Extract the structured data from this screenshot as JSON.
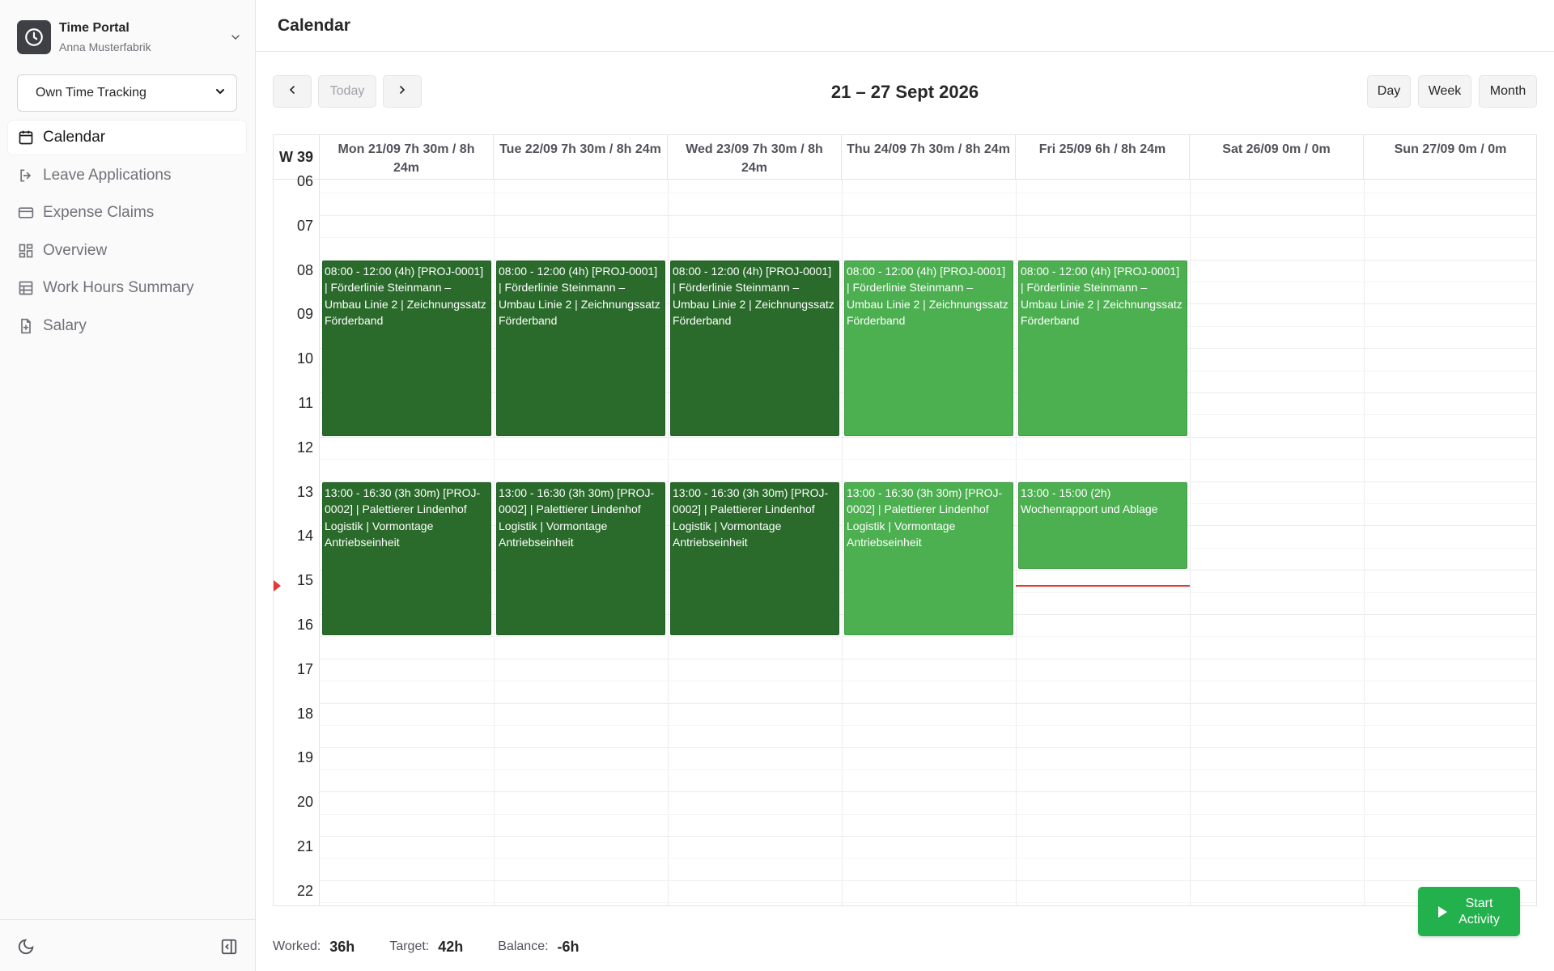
{
  "app": {
    "title": "Time Portal",
    "user": "Anna Musterfabrik"
  },
  "tracking_select": {
    "value": "Own Time Tracking"
  },
  "sidebar": {
    "items": [
      {
        "label": "Calendar",
        "icon": "calendar-icon",
        "active": true
      },
      {
        "label": "Leave Applications",
        "icon": "leave-icon"
      },
      {
        "label": "Expense Claims",
        "icon": "credit-card-icon"
      },
      {
        "label": "Overview",
        "icon": "grid-icon"
      },
      {
        "label": "Work Hours Summary",
        "icon": "table-icon"
      },
      {
        "label": "Salary",
        "icon": "document-icon"
      }
    ]
  },
  "header": {
    "title": "Calendar"
  },
  "toolbar": {
    "today_label": "Today",
    "range_title": "21 – 27 Sept 2026",
    "views": [
      "Day",
      "Week",
      "Month"
    ]
  },
  "calendar": {
    "week_label": "W 39",
    "days": [
      "Mon 21/09 7h 30m / 8h 24m",
      "Tue 22/09 7h 30m / 8h 24m",
      "Wed 23/09 7h 30m / 8h 24m",
      "Thu 24/09 7h 30m / 8h 24m",
      "Fri 25/09 6h / 8h 24m",
      "Sat 26/09 0m / 0m",
      "Sun 27/09 0m / 0m"
    ],
    "hours": [
      "06",
      "07",
      "08",
      "09",
      "10",
      "11",
      "12",
      "13",
      "14",
      "15",
      "16",
      "17",
      "18",
      "19",
      "20",
      "21",
      "22"
    ],
    "events": [
      {
        "day": 0,
        "start": 8,
        "end": 12,
        "style": "dark",
        "text": "08:00 - 12:00 (4h) [PROJ-0001] | Förderlinie Steinmann – Umbau Linie 2 | Zeichnungssatz Förderband"
      },
      {
        "day": 1,
        "start": 8,
        "end": 12,
        "style": "dark",
        "text": "08:00 - 12:00 (4h) [PROJ-0001] | Förderlinie Steinmann – Umbau Linie 2 | Zeichnungssatz Förderband"
      },
      {
        "day": 2,
        "start": 8,
        "end": 12,
        "style": "dark",
        "text": "08:00 - 12:00 (4h) [PROJ-0001] | Förderlinie Steinmann – Umbau Linie 2 | Zeichnungssatz Förderband"
      },
      {
        "day": 3,
        "start": 8,
        "end": 12,
        "style": "light",
        "text": "08:00 - 12:00 (4h) [PROJ-0001] | Förderlinie Steinmann – Umbau Linie 2 | Zeichnungssatz Förderband"
      },
      {
        "day": 4,
        "start": 8,
        "end": 12,
        "style": "light",
        "text": "08:00 - 12:00 (4h) [PROJ-0001] | Förderlinie Steinmann – Umbau Linie 2 | Zeichnungssatz Förderband"
      },
      {
        "day": 0,
        "start": 13,
        "end": 16.5,
        "style": "dark",
        "text": "13:00 - 16:30 (3h 30m) [PROJ-0002] | Palettierer Lindenhof Logistik | Vormontage Antriebseinheit"
      },
      {
        "day": 1,
        "start": 13,
        "end": 16.5,
        "style": "dark",
        "text": "13:00 - 16:30 (3h 30m) [PROJ-0002] | Palettierer Lindenhof Logistik | Vormontage Antriebseinheit"
      },
      {
        "day": 2,
        "start": 13,
        "end": 16.5,
        "style": "dark",
        "text": "13:00 - 16:30 (3h 30m) [PROJ-0002] | Palettierer Lindenhof Logistik | Vormontage Antriebseinheit"
      },
      {
        "day": 3,
        "start": 13,
        "end": 16.5,
        "style": "light",
        "text": "13:00 - 16:30 (3h 30m) [PROJ-0002] | Palettierer Lindenhof Logistik | Vormontage Antriebseinheit"
      },
      {
        "day": 4,
        "start": 13,
        "end": 15,
        "style": "light",
        "text": "13:00 - 15:00 (2h) Wochenrapport und Ablage"
      }
    ],
    "now": {
      "day": 4,
      "time": 15.35
    },
    "colors": {
      "event_dark": "#2a6b2b",
      "event_light": "#4caf50",
      "now_line": "#e53935"
    }
  },
  "fab": {
    "label": "Start Activity",
    "color": "#22b14c"
  },
  "totals": {
    "worked_label": "Worked:",
    "worked_value": "36h",
    "target_label": "Target:",
    "target_value": "42h",
    "balance_label": "Balance:",
    "balance_value": "-6h"
  }
}
